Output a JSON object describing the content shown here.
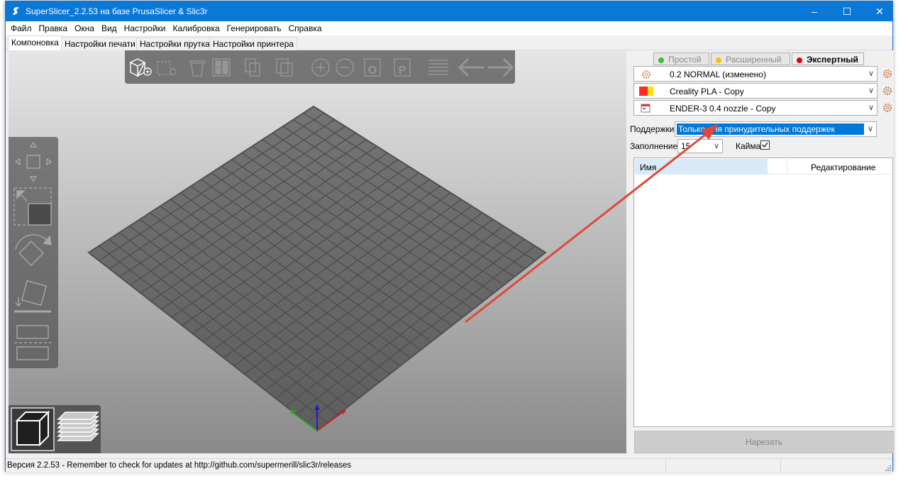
{
  "window": {
    "title": "SuperSlicer_2.2.53 на базе PrusaSlicer & Slic3r",
    "controls": [
      "minimize-icon",
      "maximize-icon",
      "close-icon"
    ]
  },
  "menu": [
    "Файл",
    "Правка",
    "Окна",
    "Вид",
    "Настройки",
    "Калибровка",
    "Генерировать",
    "Справка"
  ],
  "tabs": [
    "Компоновка",
    "Настройки печати",
    "Настройки прутка",
    "Настройки принтера"
  ],
  "active_tab": "Компоновка",
  "toolbar_icons": [
    "add-icon",
    "delete-icon",
    "delete-all-icon",
    "arrange-icon",
    "copy-icon",
    "paste-icon",
    "add-instance-icon",
    "remove-instance-icon",
    "split-objects-icon",
    "split-parts-icon",
    "layers-editing-icon",
    "undo-icon",
    "redo-icon"
  ],
  "gizmo_icons": [
    "move-icon",
    "scale-icon",
    "rotate-icon",
    "place-on-face-icon",
    "cut-icon"
  ],
  "view_icons": [
    "3d-view-icon",
    "preview-icon"
  ],
  "modes": {
    "simple": "Простой",
    "advanced": "Расширенный",
    "expert": "Экспертный",
    "active": "expert",
    "colors": {
      "simple": "#36c233",
      "advanced": "#f5c400",
      "expert": "#e00000"
    }
  },
  "presets": {
    "print": "0.2 NORMAL (изменено)",
    "filament": "Creality PLA - Copy",
    "printer": "ENDER-3 0.4 nozzle - Copy",
    "filament_colors": [
      "#ff2b2b",
      "#ffe000"
    ]
  },
  "settings": {
    "supports_label": "Поддержки:",
    "supports_value": "Только для принудительных поддержек",
    "infill_label": "Заполнение:",
    "infill_value": "15",
    "brim_label": "Кайма:",
    "brim_checked": true
  },
  "object_list": {
    "col_name": "Имя",
    "col_edit": "Редактирование"
  },
  "slice_button": "Нарезать",
  "status": "Версия 2.2.53 - Remember to check for updates at http://github.com/supermerill/slic3r/releases",
  "colors": {
    "titlebar": "#0a78d7",
    "annotation_arrow": "#e0483a",
    "selection": "#0078d7"
  }
}
